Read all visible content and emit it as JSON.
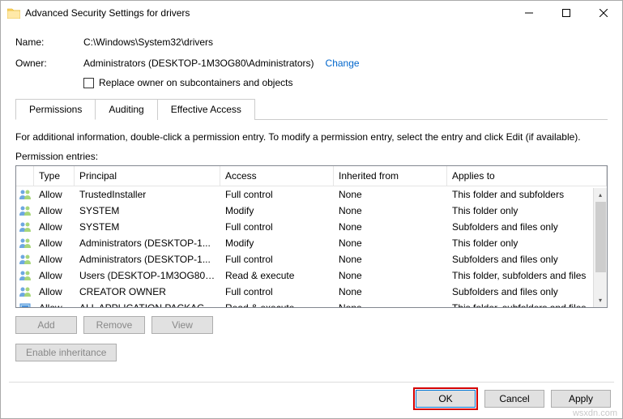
{
  "window": {
    "title": "Advanced Security Settings for drivers"
  },
  "fields": {
    "name_label": "Name:",
    "name_value": "C:\\Windows\\System32\\drivers",
    "owner_label": "Owner:",
    "owner_value": "Administrators (DESKTOP-1M3OG80\\Administrators)",
    "change_link": "Change",
    "replace_owner": "Replace owner on subcontainers and objects"
  },
  "tabs": {
    "permissions": "Permissions",
    "auditing": "Auditing",
    "effective": "Effective Access"
  },
  "info_text": "For additional information, double-click a permission entry. To modify a permission entry, select the entry and click Edit (if available).",
  "section_label": "Permission entries:",
  "columns": {
    "type": "Type",
    "principal": "Principal",
    "access": "Access",
    "inherited": "Inherited from",
    "applies": "Applies to"
  },
  "entries": [
    {
      "type": "Allow",
      "principal": "TrustedInstaller",
      "access": "Full control",
      "inherited": "None",
      "applies": "This folder and subfolders"
    },
    {
      "type": "Allow",
      "principal": "SYSTEM",
      "access": "Modify",
      "inherited": "None",
      "applies": "This folder only"
    },
    {
      "type": "Allow",
      "principal": "SYSTEM",
      "access": "Full control",
      "inherited": "None",
      "applies": "Subfolders and files only"
    },
    {
      "type": "Allow",
      "principal": "Administrators (DESKTOP-1...",
      "access": "Modify",
      "inherited": "None",
      "applies": "This folder only"
    },
    {
      "type": "Allow",
      "principal": "Administrators (DESKTOP-1...",
      "access": "Full control",
      "inherited": "None",
      "applies": "Subfolders and files only"
    },
    {
      "type": "Allow",
      "principal": "Users (DESKTOP-1M3OG80\\U...",
      "access": "Read & execute",
      "inherited": "None",
      "applies": "This folder, subfolders and files"
    },
    {
      "type": "Allow",
      "principal": "CREATOR OWNER",
      "access": "Full control",
      "inherited": "None",
      "applies": "Subfolders and files only"
    },
    {
      "type": "Allow",
      "principal": "ALL APPLICATION PACKAGES",
      "access": "Read & execute",
      "inherited": "None",
      "applies": "This folder, subfolders and files"
    }
  ],
  "buttons": {
    "add": "Add",
    "remove": "Remove",
    "view": "View",
    "enable_inheritance": "Enable inheritance",
    "ok": "OK",
    "cancel": "Cancel",
    "apply": "Apply"
  },
  "watermark": "wsxdn.com"
}
